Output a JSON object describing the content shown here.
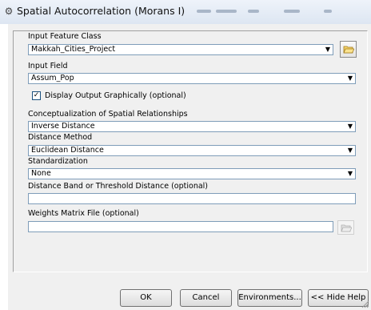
{
  "window": {
    "title": "Spatial Autocorrelation (Morans I)",
    "icon": "tool-icon"
  },
  "form": {
    "input_feature_class": {
      "label": "Input Feature Class",
      "value": "Makkah_Cities_Project"
    },
    "input_field": {
      "label": "Input Field",
      "value": "Assum_Pop"
    },
    "display_output": {
      "label": "Display Output Graphically (optional)",
      "checked": true
    },
    "conceptualization": {
      "label": "Conceptualization of Spatial Relationships",
      "value": "Inverse Distance"
    },
    "distance_method": {
      "label": "Distance Method",
      "value": "Euclidean Distance"
    },
    "standardization": {
      "label": "Standardization",
      "value": "None"
    },
    "distance_band": {
      "label": "Distance Band or Threshold Distance (optional)",
      "value": ""
    },
    "weights_matrix": {
      "label": "Weights Matrix File (optional)",
      "value": ""
    }
  },
  "buttons": {
    "ok": "OK",
    "cancel": "Cancel",
    "environments": "Environments...",
    "hide_help": "<< Hide Help"
  }
}
